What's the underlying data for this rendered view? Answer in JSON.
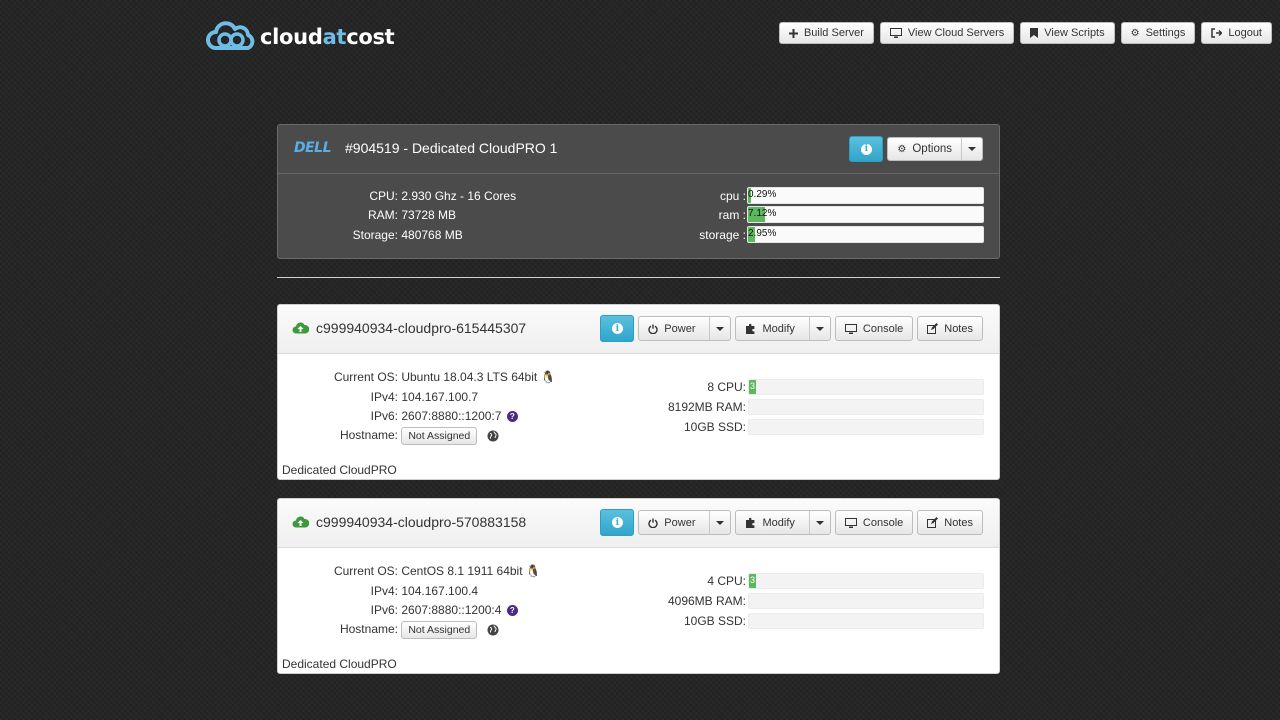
{
  "brand": {
    "logo_text_a": "cloud",
    "logo_text_b": "at",
    "logo_text_c": "cost",
    "accent": "#6fbde4"
  },
  "nav": [
    {
      "label": "Build Server",
      "icon": "plus-icon"
    },
    {
      "label": "View Cloud Servers",
      "icon": "monitor-icon"
    },
    {
      "label": "View Scripts",
      "icon": "bookmark-icon"
    },
    {
      "label": "Settings",
      "icon": "gears-icon"
    },
    {
      "label": "Logout",
      "icon": "logout-icon"
    }
  ],
  "dedicated": {
    "vendor_logo": "DELL",
    "title": "#904519 - Dedicated CloudPRO 1",
    "options_label": "Options",
    "specs": [
      {
        "label": "CPU:",
        "value": "2.930 Ghz - 16 Cores"
      },
      {
        "label": "RAM:",
        "value": "73728 MB"
      },
      {
        "label": "Storage:",
        "value": "480768 MB"
      }
    ],
    "usage": [
      {
        "label": "cpu :",
        "percent": 0.29,
        "text": "0.29%"
      },
      {
        "label": "ram :",
        "percent": 7.12,
        "text": "7.12%"
      },
      {
        "label": "storage :",
        "percent": 2.95,
        "text": "2.95%"
      }
    ]
  },
  "servers": [
    {
      "name": "c999940934-cloudpro-615445307",
      "buttons": {
        "power": "Power",
        "modify": "Modify",
        "console": "Console",
        "notes": "Notes"
      },
      "details": {
        "os_label": "Current OS:",
        "os_value": "Ubuntu 18.04.3 LTS 64bit",
        "ipv4_label": "IPv4:",
        "ipv4_value": "104.167.100.7",
        "ipv6_label": "IPv6:",
        "ipv6_value": "2607:8880::1200:7",
        "hostname_label": "Hostname:",
        "hostname_value": "Not Assigned"
      },
      "resources": [
        {
          "label": "8 CPU:",
          "percent": 3,
          "text": "3"
        },
        {
          "label": "8192MB RAM:",
          "percent": 0,
          "text": ""
        },
        {
          "label": "10GB SSD:",
          "percent": 0,
          "text": ""
        }
      ],
      "plan": "Dedicated CloudPRO"
    },
    {
      "name": "c999940934-cloudpro-570883158",
      "buttons": {
        "power": "Power",
        "modify": "Modify",
        "console": "Console",
        "notes": "Notes"
      },
      "details": {
        "os_label": "Current OS:",
        "os_value": "CentOS 8.1 1911 64bit",
        "ipv4_label": "IPv4:",
        "ipv4_value": "104.167.100.4",
        "ipv6_label": "IPv6:",
        "ipv6_value": "2607:8880::1200:4",
        "hostname_label": "Hostname:",
        "hostname_value": "Not Assigned"
      },
      "resources": [
        {
          "label": "4 CPU:",
          "percent": 3,
          "text": "3"
        },
        {
          "label": "4096MB RAM:",
          "percent": 0,
          "text": ""
        },
        {
          "label": "10GB SSD:",
          "percent": 0,
          "text": ""
        }
      ],
      "plan": "Dedicated CloudPRO"
    }
  ]
}
